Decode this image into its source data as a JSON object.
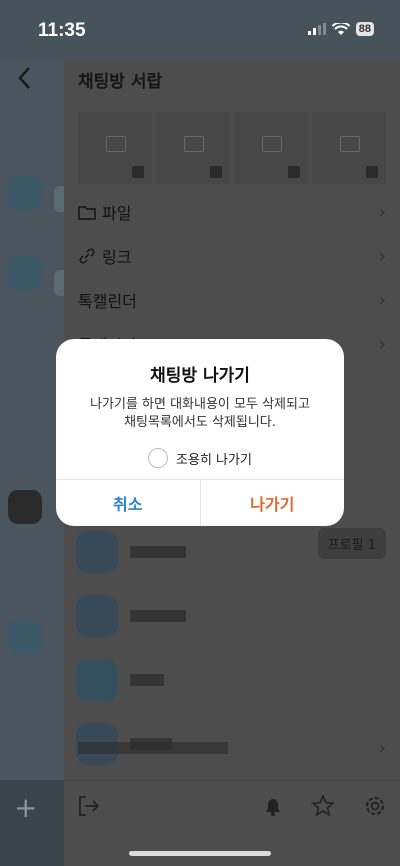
{
  "status_bar": {
    "time": "11:35",
    "battery": "88"
  },
  "drawer": {
    "title": "채팅방 서랍",
    "menu": [
      {
        "label": "파일",
        "icon": "folder-icon"
      },
      {
        "label": "링크",
        "icon": "link-icon"
      },
      {
        "label": "톡캘린더",
        "icon": ""
      },
      {
        "label": "톡게시판",
        "icon": ""
      }
    ],
    "profile_chip": "프로필 1"
  },
  "dialog": {
    "title": "채팅방 나가기",
    "message_line1": "나가기를 하면 대화내용이 모두 삭제되고",
    "message_line2": "채팅목록에서도 삭제됩니다.",
    "quiet_option": "조용히 나가기",
    "cancel": "취소",
    "leave": "나가기",
    "colors": {
      "cancel": "#2f86c9",
      "leave": "#e6672e"
    }
  }
}
